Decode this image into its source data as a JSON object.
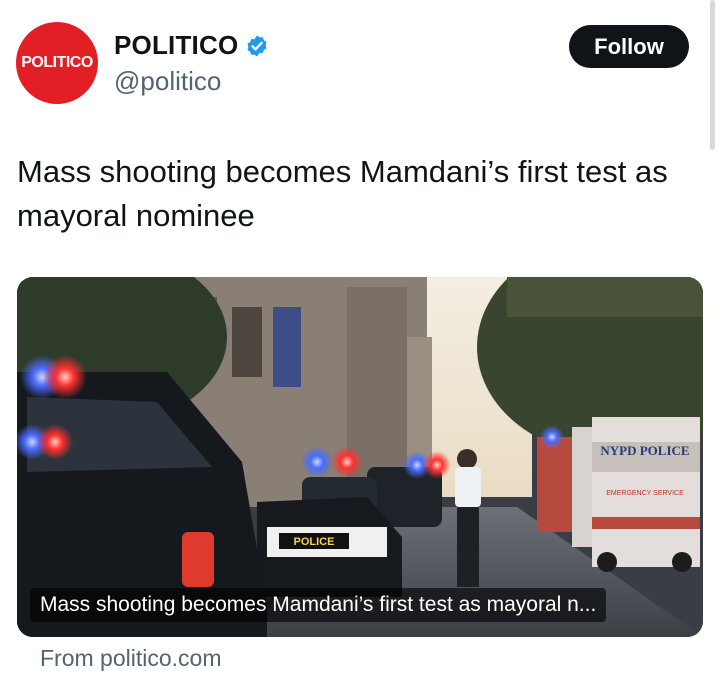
{
  "account": {
    "avatar_text": "POLITICO",
    "display_name": "POLITICO",
    "handle": "@politico",
    "verified": true,
    "brand_color": "#e31f26"
  },
  "follow_button": {
    "label": "Follow"
  },
  "tweet": {
    "text": "Mass shooting becomes Mamdani’s first test as mayoral nominee"
  },
  "card": {
    "image_label_police": "POLICE",
    "image_label_nypd": "NYPD POLICE",
    "image_label_emergency": "EMERGENCY SERVICE",
    "title": "Mass shooting becomes Mamdani’s first test as mayoral n...",
    "source": "From politico.com"
  },
  "icons": {
    "verified": "verified-badge-icon"
  }
}
